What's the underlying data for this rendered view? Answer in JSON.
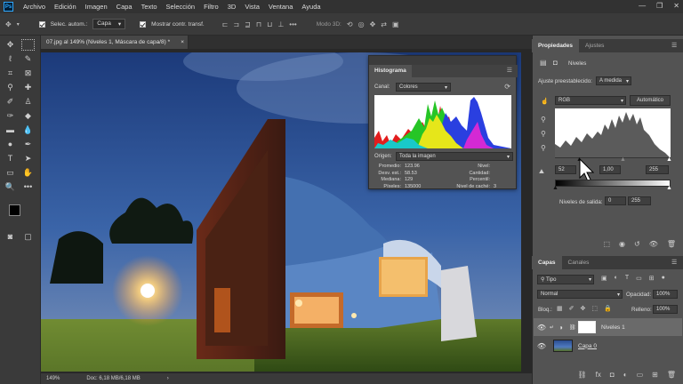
{
  "app": {
    "logo": "Ps"
  },
  "menu": [
    "Archivo",
    "Edición",
    "Imagen",
    "Capa",
    "Texto",
    "Selección",
    "Filtro",
    "3D",
    "Vista",
    "Ventana",
    "Ayuda"
  ],
  "window_controls": [
    "—",
    "❐",
    "✕"
  ],
  "options": {
    "autoselect_label": "Selec. autom.:",
    "autoselect_value": "Capa",
    "transform_label": "Mostrar contr. transf.",
    "mode3d_label": "Modo 3D:"
  },
  "document": {
    "tab_title": "07.jpg al 149% (Niveles 1, Máscara de capa/8) *",
    "close": "×",
    "zoom": "149%",
    "doc_info": "Doc: 6,18 MB/6,18 MB",
    "arrow": "›"
  },
  "histogram": {
    "title": "Histograma",
    "channel_label": "Canal:",
    "channel_value": "Colores",
    "origin_label": "Origen:",
    "origin_value": "Toda la imagen",
    "stats_left_labels": [
      "Promedio:",
      "Desv. est.:",
      "Mediana:",
      "Píxeles:"
    ],
    "stats_left_values": [
      "123.96",
      "58.53",
      "129",
      "135000"
    ],
    "stats_right_labels": [
      "Nivel:",
      "Cantidad:",
      "Percentil:",
      "Nivel de caché:"
    ],
    "stats_right_values": [
      "",
      "",
      "",
      "3"
    ]
  },
  "properties": {
    "tabs": [
      "Propiedades",
      "Ajustes"
    ],
    "title": "Niveles",
    "preset_label": "Ajuste preestablecido:",
    "preset_value": "A medida",
    "channel_value": "RGB",
    "auto_button": "Automático",
    "input_black": "52",
    "input_gamma": "1,00",
    "input_white": "255",
    "output_label": "Niveles de salida:",
    "output_black": "0",
    "output_white": "255"
  },
  "layers": {
    "tabs": [
      "Capas",
      "Canales"
    ],
    "filter_value": "Tipo",
    "blend_value": "Normal",
    "opacity_label": "Opacidad:",
    "opacity_value": "100%",
    "lock_label": "Bloq.:",
    "fill_label": "Relleno:",
    "fill_value": "100%",
    "items": [
      {
        "name": "Niveles 1"
      },
      {
        "name": "Capa 0"
      }
    ]
  },
  "colors": {
    "accent": "#31a8ff",
    "panel": "#535353",
    "dark": "#323232"
  }
}
